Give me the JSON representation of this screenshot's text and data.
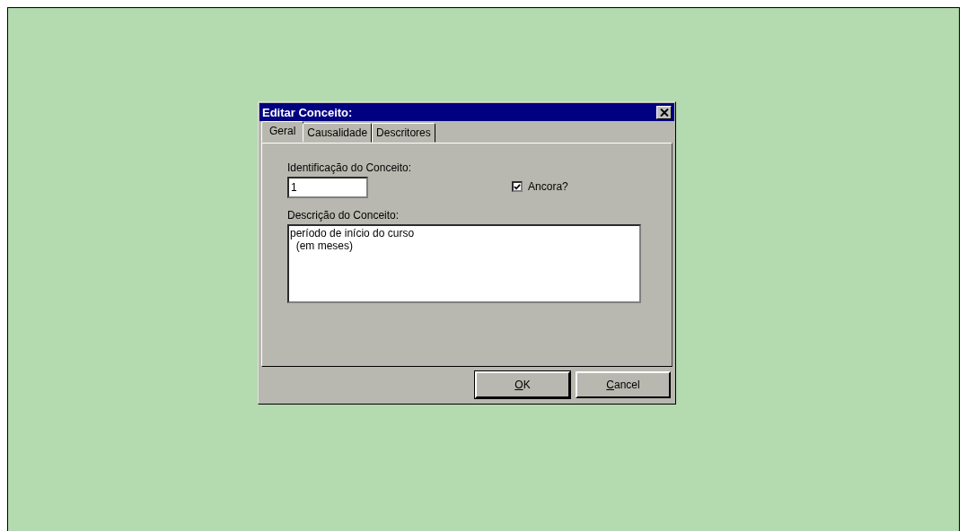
{
  "window": {
    "title": "Editar Conceito:"
  },
  "tabs": [
    {
      "label": "Geral",
      "selected": true
    },
    {
      "label": "Causalidade",
      "selected": false
    },
    {
      "label": "Descritores",
      "selected": false
    }
  ],
  "id_field": {
    "label": "Identificação do Conceito:",
    "value": "1"
  },
  "anchor_checkbox": {
    "label": "Ancora?",
    "checked": true
  },
  "description": {
    "label": "Descrição do Conceito:",
    "value": "período de início do curso\n  (em meses)"
  },
  "buttons": [
    {
      "label": "OK",
      "default": true
    },
    {
      "label": "Cancel",
      "default": false
    }
  ]
}
